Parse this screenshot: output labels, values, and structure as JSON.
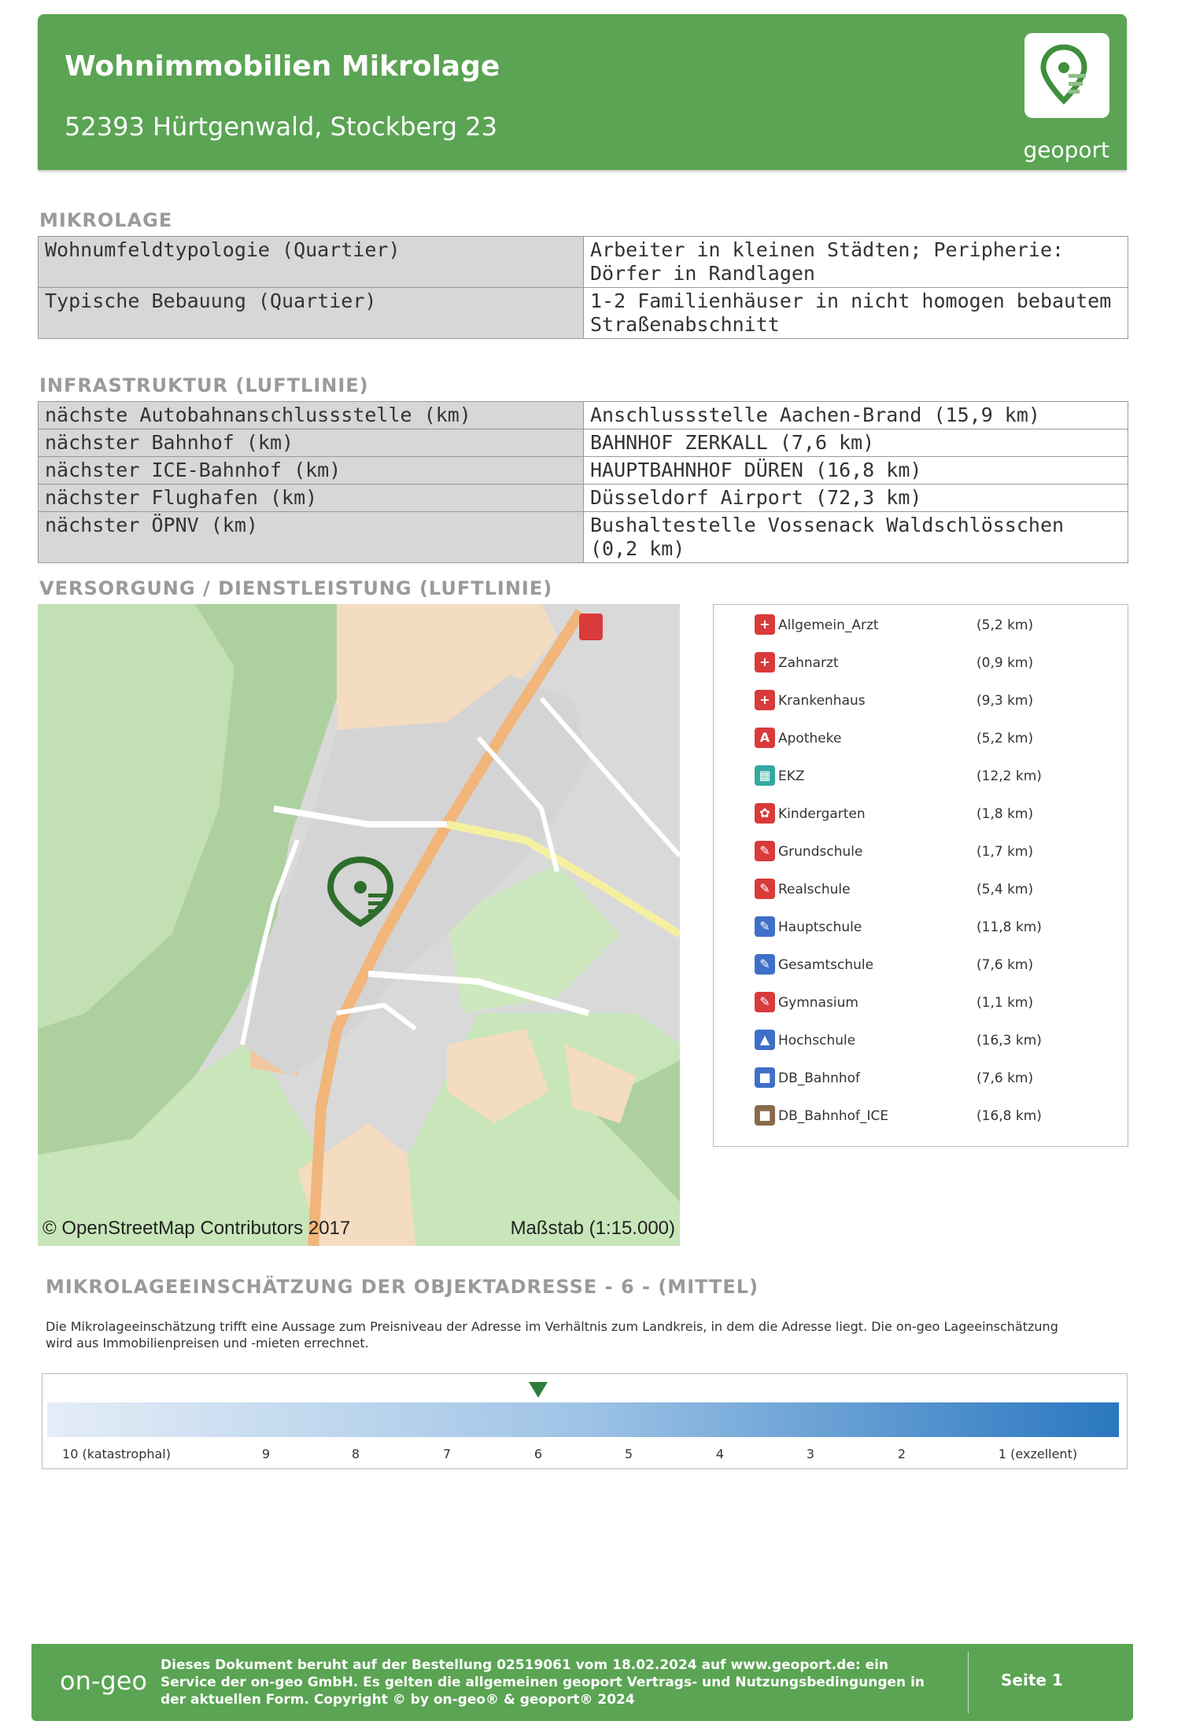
{
  "header": {
    "title": "Wohnimmobilien Mikrolage",
    "address": "52393 Hürtgenwald, Stockberg 23",
    "logo_text": "geoport"
  },
  "mikrolage": {
    "title": "MIKROLAGE",
    "rows": [
      {
        "key": "Wohnumfeldtypologie (Quartier)",
        "value": "Arbeiter in kleinen Städten; Peripherie: Dörfer in Randlagen"
      },
      {
        "key": "Typische Bebauung (Quartier)",
        "value": "1-2 Familienhäuser in nicht homogen bebautem Straßenabschnitt"
      }
    ]
  },
  "infrastruktur": {
    "title": "INFRASTRUKTUR (LUFTLINIE)",
    "rows": [
      {
        "key": "nächste Autobahnanschlussstelle (km)",
        "value": "Anschlussstelle Aachen-Brand (15,9 km)"
      },
      {
        "key": "nächster Bahnhof (km)",
        "value": "BAHNHOF ZERKALL (7,6 km)"
      },
      {
        "key": "nächster ICE-Bahnhof (km)",
        "value": "HAUPTBAHNHOF DÜREN (16,8 km)"
      },
      {
        "key": "nächster Flughafen (km)",
        "value": "Düsseldorf Airport (72,3 km)"
      },
      {
        "key": "nächster ÖPNV (km)",
        "value": "Bushaltestelle Vossenack Waldschlösschen (0,2 km)"
      }
    ]
  },
  "versorgung": {
    "title": "VERSORGUNG / DIENSTLEISTUNG (LUFTLINIE)",
    "map_credit": "© OpenStreetMap Contributors 2017",
    "map_scale": "Maßstab (1:15.000)",
    "legend": [
      {
        "label": "Allgemein_Arzt",
        "dist": "(5,2 km)",
        "color": "#d93a3a",
        "icon": "doctor-icon"
      },
      {
        "label": "Zahnarzt",
        "dist": "(0,9 km)",
        "color": "#d93a3a",
        "icon": "tooth-icon"
      },
      {
        "label": "Krankenhaus",
        "dist": "(9,3 km)",
        "color": "#d93a3a",
        "icon": "hospital-icon"
      },
      {
        "label": "Apotheke",
        "dist": "(5,2 km)",
        "color": "#d93a3a",
        "icon": "pharmacy-icon"
      },
      {
        "label": "EKZ",
        "dist": "(12,2 km)",
        "color": "#35a8a0",
        "icon": "shopping-icon"
      },
      {
        "label": "Kindergarten",
        "dist": "(1,8 km)",
        "color": "#d93a3a",
        "icon": "kindergarten-icon"
      },
      {
        "label": "Grundschule",
        "dist": "(1,7 km)",
        "color": "#d93a3a",
        "icon": "school-icon"
      },
      {
        "label": "Realschule",
        "dist": "(5,4 km)",
        "color": "#d93a3a",
        "icon": "school-icon"
      },
      {
        "label": "Hauptschule",
        "dist": "(11,8 km)",
        "color": "#3f6fc9",
        "icon": "school-icon"
      },
      {
        "label": "Gesamtschule",
        "dist": "(7,6 km)",
        "color": "#3f6fc9",
        "icon": "school-icon"
      },
      {
        "label": "Gymnasium",
        "dist": "(1,1 km)",
        "color": "#d93a3a",
        "icon": "school-icon"
      },
      {
        "label": "Hochschule",
        "dist": "(16,3 km)",
        "color": "#3f6fc9",
        "icon": "university-icon"
      },
      {
        "label": "DB_Bahnhof",
        "dist": "(7,6 km)",
        "color": "#3f6fc9",
        "icon": "train-icon"
      },
      {
        "label": "DB_Bahnhof_ICE",
        "dist": "(16,8 km)",
        "color": "#8a6a4a",
        "icon": "train-icon"
      }
    ]
  },
  "assessment": {
    "title": "MIKROLAGEEINSCHÄTZUNG DER OBJEKTADRESSE - 6 - (MITTEL)",
    "text": "Die Mikrolageeinschätzung trifft eine Aussage zum Preisniveau der Adresse im Verhältnis zum Landkreis, in dem die Adresse liegt. Die on-geo Lageeinschätzung wird aus Immobilienpreisen und -mieten errechnet.",
    "score": 6,
    "ticks": [
      "10 (katastrophal)",
      "9",
      "8",
      "7",
      "6",
      "5",
      "4",
      "3",
      "2",
      "1 (exzellent)"
    ]
  },
  "footer": {
    "brand": "on-geo",
    "text": "Dieses Dokument beruht auf der Bestellung 02519061 vom 18.02.2024 auf www.geoport.de: ein Service der on-geo GmbH. Es gelten die allgemeinen geoport Vertrags- und Nutzungsbedingungen in der aktuellen Form. Copyright © by on-geo® & geoport® 2024",
    "page": "Seite 1"
  }
}
